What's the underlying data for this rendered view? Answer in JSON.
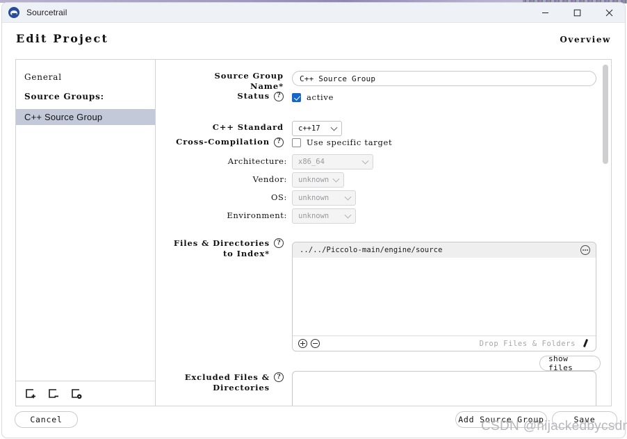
{
  "titlebar": {
    "app_name": "Sourcetrail",
    "app_icon": "sourcetrail-logo-icon",
    "minimize": "minimize-icon",
    "maximize": "maximize-icon",
    "close": "close-icon"
  },
  "header": {
    "title": "Edit Project",
    "overview_link": "Overview"
  },
  "sidebar": {
    "general_label": "General",
    "source_groups_label": "Source Groups:",
    "items": [
      {
        "label": "C++ Source Group",
        "selected": true
      }
    ],
    "toolbar": [
      {
        "name": "add-source-group-icon",
        "title": "Add"
      },
      {
        "name": "remove-source-group-icon",
        "title": "Remove"
      },
      {
        "name": "duplicate-source-group-icon",
        "title": "Duplicate"
      }
    ]
  },
  "form": {
    "name_label": "Source Group\nName*",
    "name_label_line1": "Source Group",
    "name_label_line2": "Name*",
    "name_value": "C++ Source Group",
    "status_label": "Status",
    "status_checkbox_label": "active",
    "status_checked": true,
    "cpp_standard_label": "C++ Standard",
    "cpp_standard_value": "c++17",
    "cross_compilation_label": "Cross-Compilation",
    "use_specific_target_label": "Use specific target",
    "use_specific_target_checked": false,
    "architecture_label": "Architecture:",
    "architecture_value": "x86_64",
    "vendor_label": "Vendor:",
    "vendor_value": "unknown",
    "os_label": "OS:",
    "os_value": "unknown",
    "environment_label": "Environment:",
    "environment_value": "unknown",
    "files_label_line1": "Files & Directories",
    "files_label_line2": "to Index*",
    "files_entries": [
      "../../Piccolo-main/engine/source"
    ],
    "drop_hint": "Drop Files & Folders",
    "show_files_label": "show files",
    "excluded_label_line1": "Excluded Files &",
    "excluded_label_line2": "Directories",
    "excluded_entries": [],
    "help_glyph": "?"
  },
  "footer": {
    "cancel_label": "Cancel",
    "add_source_group_label": "Add Source Group",
    "save_label": "Save"
  },
  "watermark": {
    "text": "CSDN @hijackedbycsdn"
  },
  "colors": {
    "accent": "#1668c8",
    "selection": "#c4c9da",
    "titlebar_bg": "#eef2f7",
    "row_bg": "#efefef"
  }
}
